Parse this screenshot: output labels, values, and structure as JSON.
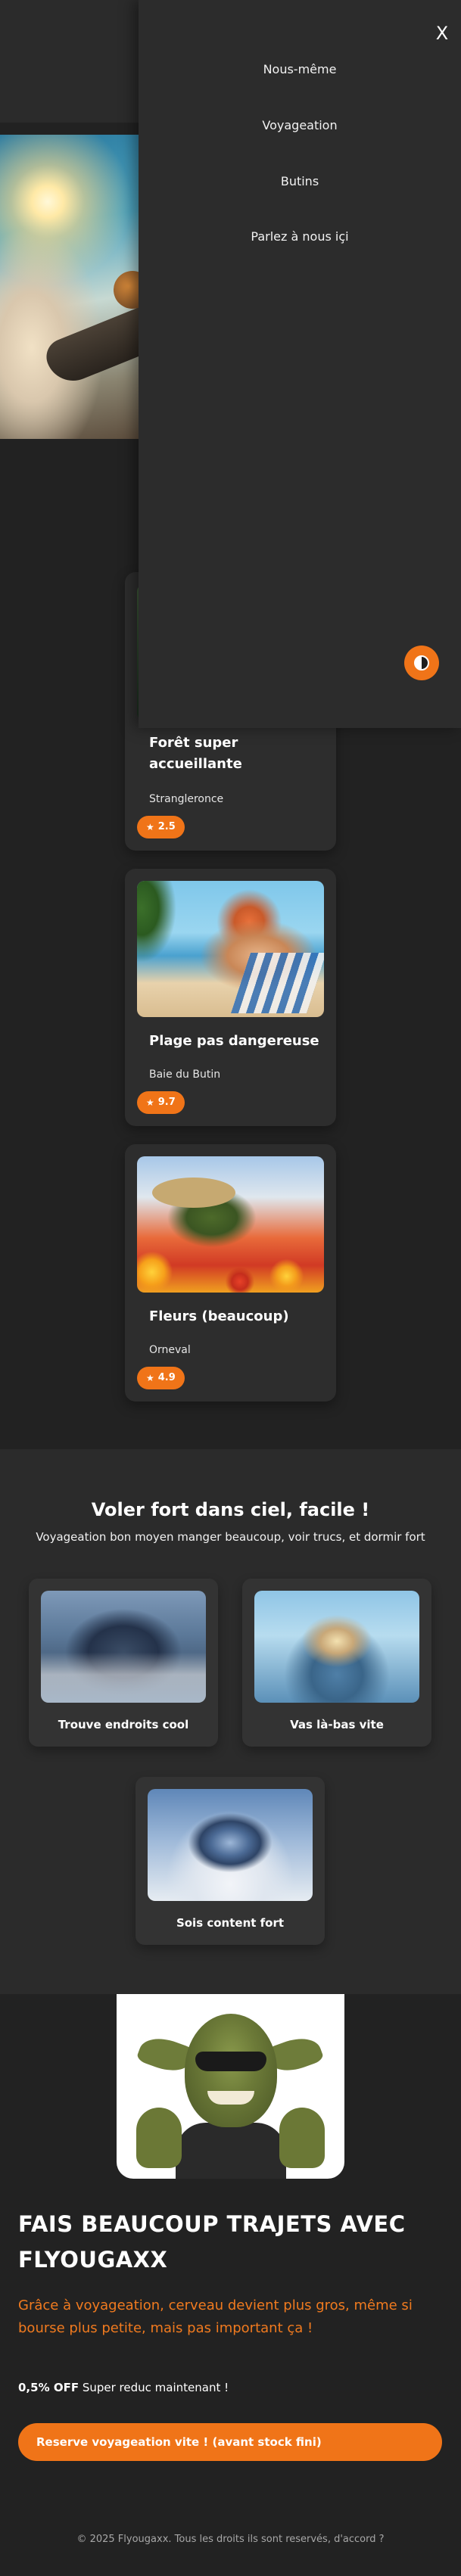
{
  "menu": {
    "close_label": "X",
    "items": [
      {
        "label": "Nous-même"
      },
      {
        "label": "Voyageation"
      },
      {
        "label": "Butins"
      },
      {
        "label": "Parlez à nous içi"
      }
    ],
    "toggle_icon": "half-circle-theme-icon"
  },
  "destinations": [
    {
      "title_line1": "Forêt super",
      "title_line2": "accueillante",
      "place": "Strangleronce",
      "rating": "2.5"
    },
    {
      "title_line1": "Plage pas dangereuse",
      "title_line2": "",
      "place": "Baie du Butin",
      "rating": "9.7"
    },
    {
      "title_line1": "Fleurs (beaucoup)",
      "title_line2": "",
      "place": "Orneval",
      "rating": "4.9"
    }
  ],
  "features": {
    "heading": "Voler fort dans ciel, facile !",
    "subheading": "Voyageation bon moyen manger beaucoup, voir trucs, et dormir fort",
    "items": [
      {
        "label": "Trouve endroits cool"
      },
      {
        "label": "Vas là-bas vite"
      },
      {
        "label": "Sois content fort"
      }
    ]
  },
  "promo": {
    "title_line1": "FAIS BEAUCOUP TRAJETS AVEC",
    "title_line2": "FLYOUGAXX",
    "description": "Grâce à voyageation, cerveau devient plus gros, même si bourse plus petite, mais pas important ça !",
    "offer_bold": "0,5% OFF",
    "offer_text": " Super reduc maintenant !",
    "cta_label": "Reserve voyageation vite ! (avant stock fini)"
  },
  "footer": {
    "text": "© 2025 Flyougaxx. Tous les droits ils sont reservés, d'accord ?"
  },
  "colors": {
    "accent": "#f07418",
    "background": "#222222",
    "panel": "#2c2c2c",
    "card": "#2d2d2d"
  }
}
